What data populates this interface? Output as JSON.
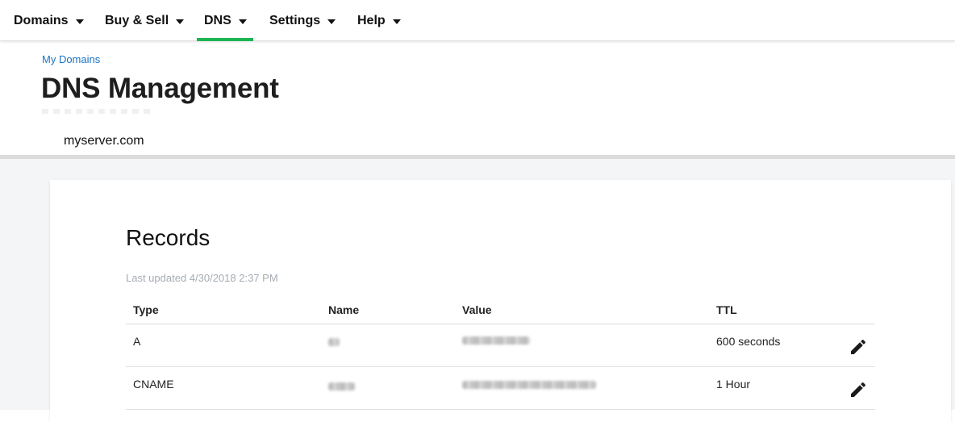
{
  "nav": {
    "items": [
      {
        "label": "Domains"
      },
      {
        "label": "Buy & Sell"
      },
      {
        "label": "DNS",
        "active": true
      },
      {
        "label": "Settings"
      },
      {
        "label": "Help"
      }
    ]
  },
  "breadcrumb": "My Domains",
  "page_title": "DNS Management",
  "domain": "myserver.com",
  "records": {
    "title": "Records",
    "last_updated": "Last updated 4/30/2018 2:37 PM",
    "columns": {
      "type": "Type",
      "name": "Name",
      "value": "Value",
      "ttl": "TTL"
    },
    "rows": [
      {
        "type": "A",
        "ttl": "600 seconds",
        "edit_icon": "pencil-icon"
      },
      {
        "type": "CNAME",
        "ttl": "1 Hour",
        "edit_icon": "pencil-icon"
      }
    ]
  },
  "colors": {
    "active_tab_underline": "#1bb552",
    "link": "#1a73c6",
    "page_background": "#f4f5f6",
    "muted_text": "#a5acb3"
  }
}
